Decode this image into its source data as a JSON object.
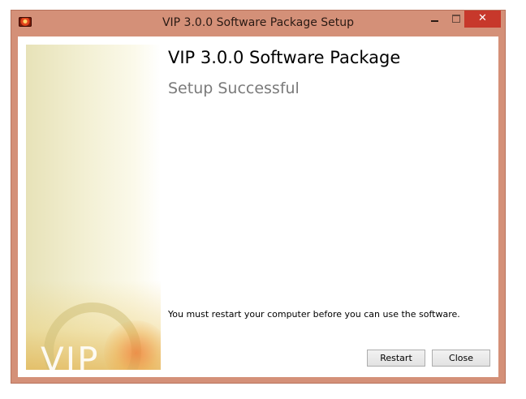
{
  "window": {
    "title": "VIP 3.0.0 Software Package Setup",
    "controls": {
      "close_glyph": "✕"
    },
    "icons": {
      "app": "app-icon",
      "minimize": "minimize-icon",
      "maximize": "maximize-icon",
      "close": "close-icon"
    },
    "colors": {
      "frame": "#d49078",
      "close_button": "#c7382b"
    }
  },
  "banner": {
    "logo_text": "VIP"
  },
  "content": {
    "heading": "VIP 3.0.0 Software Package",
    "subheading": "Setup Successful",
    "message": "You must restart your computer before you can use the software."
  },
  "buttons": {
    "restart": "Restart",
    "close": "Close"
  }
}
